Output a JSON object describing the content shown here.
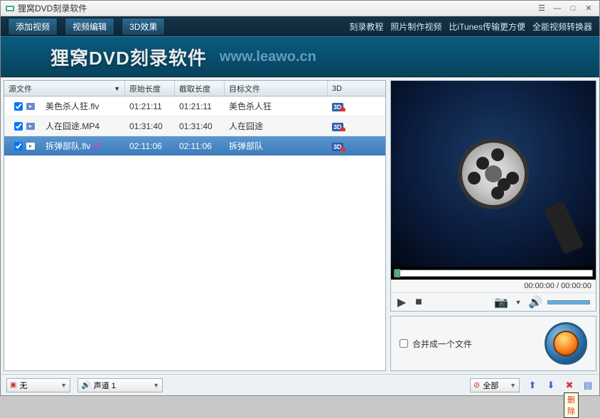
{
  "title": "狸窝DVD刻录软件",
  "toolbar": {
    "add_video": "添加视频",
    "video_edit": "视频编辑",
    "effect_3d": "3D效果"
  },
  "toplinks": [
    "刻录教程",
    "照片制作视频",
    "比iTunes传输更方便",
    "全能视频转换器"
  ],
  "banner": {
    "title": "狸窝DVD刻录软件",
    "url": "www.leawo.cn"
  },
  "columns": {
    "source": "源文件",
    "orig_len": "原始长度",
    "cut_len": "截取长度",
    "target": "目标文件",
    "td3d": "3D"
  },
  "rows": [
    {
      "checked": true,
      "file": "美色杀人狂.flv",
      "orig": "01:21:11",
      "cut": "01:21:11",
      "target": "美色杀人狂",
      "mark": false,
      "selected": false
    },
    {
      "checked": true,
      "file": "人在囧途.MP4",
      "orig": "01:31:40",
      "cut": "01:31:40",
      "target": "人在囧途",
      "mark": false,
      "selected": false
    },
    {
      "checked": true,
      "file": "拆弹部队.flv",
      "orig": "02:11:06",
      "cut": "02:11:06",
      "target": "拆弹部队",
      "mark": true,
      "selected": true
    }
  ],
  "time": "00:00:00 / 00:00:00",
  "merge": "合并成一个文件",
  "bottom": {
    "subtitle_none": "无",
    "audio_track": "声道 1",
    "apply_all": "全部"
  },
  "tooltip_delete": "删除"
}
